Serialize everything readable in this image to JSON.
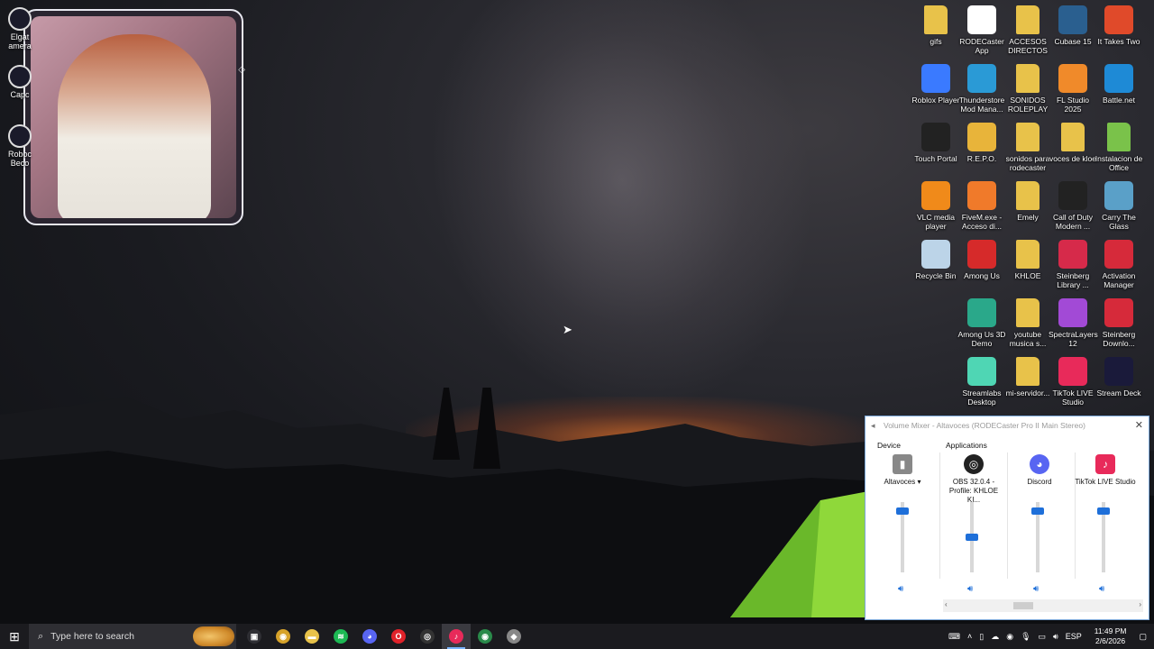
{
  "desktop_icons": [
    {
      "label": "gifs",
      "icon": "folder-icon",
      "color": "#e8c24a"
    },
    {
      "label": "RODECaster App",
      "icon": "rodecaster-icon",
      "color": "#ffffff"
    },
    {
      "label": "ACCESOS DIRECTOS",
      "icon": "folder-icon",
      "color": "#e8c24a"
    },
    {
      "label": "Cubase 15",
      "icon": "cubase-icon",
      "color": "#2a5f8f"
    },
    {
      "label": "It Takes Two",
      "icon": "ittakestwo-icon",
      "color": "#e04a2a"
    },
    {
      "label": "Roblox Player",
      "icon": "roblox-icon",
      "color": "#3a7aff"
    },
    {
      "label": "Thunderstore Mod Mana...",
      "icon": "thunderstore-icon",
      "color": "#2a9ad6"
    },
    {
      "label": "SONIDOS ROLEPLAY",
      "icon": "folder-icon",
      "color": "#e8c24a"
    },
    {
      "label": "FL Studio 2025",
      "icon": "flstudio-icon",
      "color": "#f08a2a"
    },
    {
      "label": "Battle.net",
      "icon": "battlenet-icon",
      "color": "#1e8ad6"
    },
    {
      "label": "Touch Portal",
      "icon": "touchportal-icon",
      "color": "#222222"
    },
    {
      "label": "R.E.P.O.",
      "icon": "repo-icon",
      "color": "#e8b43a"
    },
    {
      "label": "sonidos para rodecaster",
      "icon": "folder-icon",
      "color": "#e8c24a"
    },
    {
      "label": "voces de kloe",
      "icon": "folder-icon",
      "color": "#e8c24a"
    },
    {
      "label": "Instalacion de Office",
      "icon": "folder-icon",
      "color": "#7ac24a"
    },
    {
      "label": "VLC media player",
      "icon": "vlc-icon",
      "color": "#f08a1a"
    },
    {
      "label": "FiveM.exe - Acceso di...",
      "icon": "fivem-icon",
      "color": "#f07a2a"
    },
    {
      "label": "Emely",
      "icon": "folder-icon",
      "color": "#e8c24a"
    },
    {
      "label": "Call of Duty Modern ...",
      "icon": "cod-icon",
      "color": "#222222"
    },
    {
      "label": "Carry The Glass",
      "icon": "carryglass-icon",
      "color": "#5aa0c8"
    },
    {
      "label": "Recycle Bin",
      "icon": "recycle-bin-icon",
      "color": "#bcd4e8"
    },
    {
      "label": "Among Us",
      "icon": "amongus-icon",
      "color": "#d62a2a"
    },
    {
      "label": "KHLOE",
      "icon": "folder-icon",
      "color": "#e8c24a"
    },
    {
      "label": "Steinberg Library ...",
      "icon": "steinberg-library-icon",
      "color": "#d62a4a"
    },
    {
      "label": "Activation Manager",
      "icon": "activation-icon",
      "color": "#d62a3a"
    },
    {
      "label": "Among Us 3D Demo",
      "icon": "amongus3d-icon",
      "color": "#2aa88a"
    },
    {
      "label": "youtube musica s...",
      "icon": "folder-icon",
      "color": "#e8c24a"
    },
    {
      "label": "SpectraLayers 12",
      "icon": "spectralayers-icon",
      "color": "#a24ad6"
    },
    {
      "label": "Steinberg Downlo...",
      "icon": "steinberg-download-icon",
      "color": "#d62a3a"
    },
    {
      "label": "Streamlabs Desktop",
      "icon": "streamlabs-icon",
      "color": "#4fd6b4"
    },
    {
      "label": "mi-servidor...",
      "icon": "folder-icon",
      "color": "#e8c24a"
    },
    {
      "label": "TikTok LIVE Studio",
      "icon": "tiktok-icon",
      "color": "#e82a5a"
    },
    {
      "label": "Stream Deck",
      "icon": "streamdeck-icon",
      "color": "#1a1a3a"
    }
  ],
  "edge_icons": [
    {
      "label": "Elgat amera",
      "icon": "elgato-icon"
    },
    {
      "label": "Capc",
      "icon": "capcut-icon"
    },
    {
      "label": "Roboc Beco",
      "icon": "edge-app-icon"
    }
  ],
  "mixer": {
    "title": "Volume Mixer - Altavoces (RODECaster Pro II Main Stereo)",
    "device_header": "Device",
    "apps_header": "Applications",
    "device": {
      "label": "Altavoces",
      "level": 0.92
    },
    "apps": [
      {
        "label": "OBS 32.0.4 - Profile: KHLOE KI...",
        "icon": "obs-icon",
        "level": 0.5
      },
      {
        "label": "Discord",
        "icon": "discord-icon",
        "level": 0.92
      },
      {
        "label": "TikTok LIVE Studio",
        "icon": "tiktok-icon",
        "level": 0.92
      }
    ]
  },
  "taskbar": {
    "search_placeholder": "Type here to search",
    "apps": [
      {
        "name": "task-view-icon",
        "glyph": "▣",
        "color": "#2e2e33"
      },
      {
        "name": "chrome-icon",
        "glyph": "◉",
        "color": "#d6a22a"
      },
      {
        "name": "file-explorer-icon",
        "glyph": "▬",
        "color": "#e8c24a"
      },
      {
        "name": "spotify-icon",
        "glyph": "≋",
        "color": "#1db954"
      },
      {
        "name": "discord-taskbar-icon",
        "glyph": "◕",
        "color": "#5865f2"
      },
      {
        "name": "opera-icon",
        "glyph": "O",
        "color": "#e0222a"
      },
      {
        "name": "obs-taskbar-icon",
        "glyph": "◎",
        "color": "#333333"
      },
      {
        "name": "tiktok-taskbar-icon",
        "glyph": "♪",
        "color": "#e82a5a",
        "active": true
      },
      {
        "name": "chrome-alt-icon",
        "glyph": "◉",
        "color": "#2a8a4a"
      },
      {
        "name": "shield-app-icon",
        "glyph": "◆",
        "color": "#888888"
      }
    ],
    "tray_lang": "ESP",
    "time": "11:49 PM",
    "date": "2/6/2026"
  }
}
